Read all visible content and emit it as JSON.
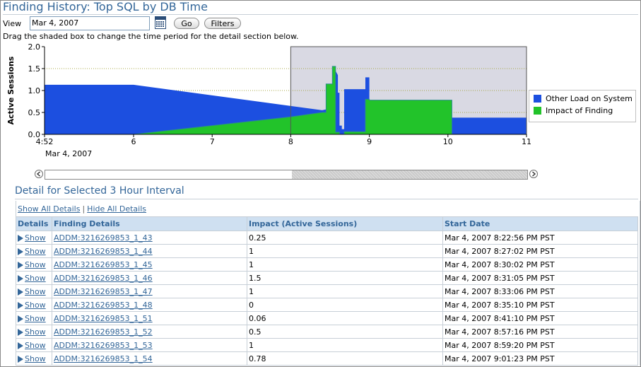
{
  "header": {
    "title": "Finding History: Top SQL by DB Time",
    "view_label": "View",
    "date_value": "Mar 4, 2007",
    "go_label": "Go",
    "filters_label": "Filters",
    "instruction": "Drag the shaded box to change the time period for the detail section below."
  },
  "chart_data": {
    "type": "area",
    "ylabel": "Active Sessions",
    "ylim": [
      0,
      2.0
    ],
    "y_ticks": [
      "0.0",
      "0.5",
      "1.0",
      "1.5",
      "2.0"
    ],
    "x_ticks": [
      "4:52",
      "6",
      "7",
      "8",
      "9",
      "10",
      "11"
    ],
    "x_tick_values": [
      4.8667,
      6,
      7,
      8,
      9,
      10,
      11
    ],
    "x_date_label": "Mar 4, 2007",
    "xlim": [
      4.8667,
      11
    ],
    "selection": [
      8,
      11
    ],
    "legend_position": "right",
    "colors": {
      "other_load": "#1c4fe0",
      "impact": "#22c32a",
      "selection_fill": "#d9d9e3",
      "impact_outline": "#2a8c8c"
    },
    "series": [
      {
        "name": "Other Load on System",
        "points": [
          [
            4.8667,
            1.13
          ],
          [
            6,
            1.13
          ],
          [
            8.4,
            0.55
          ],
          [
            8.53,
            0.6
          ],
          [
            8.53,
            0.78
          ],
          [
            8.57,
            0.75
          ],
          [
            8.57,
            1.45
          ],
          [
            8.6,
            1.35
          ],
          [
            8.6,
            0.95
          ],
          [
            8.62,
            0.95
          ],
          [
            8.62,
            0.2
          ],
          [
            8.65,
            0.2
          ],
          [
            8.65,
            0.12
          ],
          [
            8.68,
            0.12
          ],
          [
            8.68,
            1.03
          ],
          [
            8.95,
            1.03
          ],
          [
            8.95,
            1.3
          ],
          [
            9.0,
            1.3
          ],
          [
            9.0,
            0.78
          ],
          [
            10.05,
            0.78
          ],
          [
            10.05,
            0.38
          ],
          [
            11,
            0.38
          ]
        ]
      },
      {
        "name": "Impact of Finding",
        "points": [
          [
            4.8667,
            0
          ],
          [
            6,
            0
          ],
          [
            8.0,
            0.4
          ],
          [
            8.4,
            0.5
          ],
          [
            8.45,
            0.5
          ],
          [
            8.45,
            1.15
          ],
          [
            8.53,
            1.15
          ],
          [
            8.53,
            1.55
          ],
          [
            8.57,
            1.55
          ],
          [
            8.57,
            0.05
          ],
          [
            8.62,
            0.05
          ],
          [
            8.62,
            0
          ],
          [
            8.68,
            0
          ],
          [
            8.68,
            0.06
          ],
          [
            8.95,
            0.06
          ],
          [
            8.95,
            0.8
          ],
          [
            9.0,
            0.8
          ],
          [
            9.0,
            0.78
          ],
          [
            10.05,
            0.78
          ],
          [
            10.05,
            0
          ],
          [
            11,
            0
          ]
        ]
      }
    ]
  },
  "detail": {
    "heading": "Detail for Selected 3 Hour Interval",
    "show_all": "Show All Details",
    "hide_all": "Hide All Details",
    "columns": [
      "Details",
      "Finding Details",
      "Impact (Active Sessions)",
      "Start Date"
    ],
    "rows": [
      {
        "show": "Show",
        "finding": "ADDM:3216269853_1_43",
        "impact": "0.25",
        "start": "Mar 4, 2007 8:22:56 PM PST"
      },
      {
        "show": "Show",
        "finding": "ADDM:3216269853_1_44",
        "impact": "1",
        "start": "Mar 4, 2007 8:27:02 PM PST"
      },
      {
        "show": "Show",
        "finding": "ADDM:3216269853_1_45",
        "impact": "1",
        "start": "Mar 4, 2007 8:30:02 PM PST"
      },
      {
        "show": "Show",
        "finding": "ADDM:3216269853_1_46",
        "impact": "1.5",
        "start": "Mar 4, 2007 8:31:05 PM PST"
      },
      {
        "show": "Show",
        "finding": "ADDM:3216269853_1_47",
        "impact": "1",
        "start": "Mar 4, 2007 8:33:06 PM PST"
      },
      {
        "show": "Show",
        "finding": "ADDM:3216269853_1_48",
        "impact": "0",
        "start": "Mar 4, 2007 8:35:10 PM PST"
      },
      {
        "show": "Show",
        "finding": "ADDM:3216269853_1_51",
        "impact": "0.06",
        "start": "Mar 4, 2007 8:41:10 PM PST"
      },
      {
        "show": "Show",
        "finding": "ADDM:3216269853_1_52",
        "impact": "0.5",
        "start": "Mar 4, 2007 8:57:16 PM PST"
      },
      {
        "show": "Show",
        "finding": "ADDM:3216269853_1_53",
        "impact": "1",
        "start": "Mar 4, 2007 8:59:20 PM PST"
      },
      {
        "show": "Show",
        "finding": "ADDM:3216269853_1_54",
        "impact": "0.78",
        "start": "Mar 4, 2007 9:01:23 PM PST"
      }
    ]
  }
}
